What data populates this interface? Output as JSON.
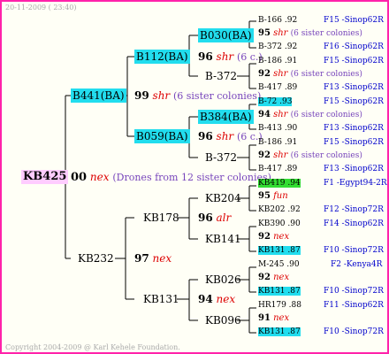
{
  "date": "20-11-2009 ( 23:40)",
  "footer": "Copyright 2004-2009 @ Karl Kehele Foundation.",
  "root": {
    "id": "KB425",
    "gen_num": "00",
    "breed": "nex",
    "note": "(Drones from 12 sister colonies)"
  },
  "top": {
    "id": "B441(BA)",
    "gen_num": "99",
    "breed": "shr",
    "note": "(6 sister colonies)",
    "a": {
      "id": "B112(BA)",
      "gen_num": "96",
      "breed": "shr",
      "note": "(6 c.)",
      "a": {
        "id": "B030(BA)"
      },
      "b": {
        "id": "B-372"
      }
    },
    "b": {
      "id": "B059(BA)",
      "gen_num": "96",
      "breed": "shr",
      "note": "(6 c.)",
      "a": {
        "id": "B384(BA)"
      },
      "b": {
        "id": "B-372"
      }
    }
  },
  "bottom": {
    "id": "KB232",
    "gen_num": "97",
    "breed": "nex",
    "a": {
      "id": "KB178",
      "gen_num": "96",
      "breed": "alr",
      "a": {
        "id": "KB204"
      },
      "b": {
        "id": "KB141"
      }
    },
    "b": {
      "id": "KB131",
      "gen_num": "94",
      "breed": "nex",
      "a": {
        "id": "KB026"
      },
      "b": {
        "id": "KB096"
      }
    }
  },
  "groups": [
    {
      "top": "B-166 .92",
      "top_loc": "F15 -Sinop62R",
      "mid_num": "95",
      "mid_breed": "shr",
      "mid_note": "(6 sister colonies)",
      "bot": "B-372 .92",
      "bot_loc": "F16 -Sinop62R"
    },
    {
      "top": "B-186 .91",
      "top_loc": "F15 -Sinop62R",
      "mid_num": "92",
      "mid_breed": "shr",
      "mid_note": "(6 sister colonies)",
      "bot": "B-417 .89",
      "bot_loc": "F13 -Sinop62R"
    },
    {
      "top": "B-72 .93",
      "top_loc": "F15 -Sinop62R",
      "mid_num": "94",
      "mid_breed": "shr",
      "mid_note": "(6 sister colonies)",
      "bot": "B-413 .90",
      "bot_loc": "F13 -Sinop62R"
    },
    {
      "top": "B-186 .91",
      "top_loc": "F15 -Sinop62R",
      "mid_num": "92",
      "mid_breed": "shr",
      "mid_note": "(6 sister colonies)",
      "bot": "B-417 .89",
      "bot_loc": "F13 -Sinop62R"
    },
    {
      "top": "KB419 .94",
      "top_loc": "F1 -Egypt94-2R",
      "mid_num": "95",
      "mid_breed": "fun",
      "mid_note": "",
      "bot": "KB202 .92",
      "bot_loc": "F12 -Sinop72R"
    },
    {
      "top": "KB390 .90",
      "top_loc": "F14 -Sinop62R",
      "mid_num": "92",
      "mid_breed": "nex",
      "mid_note": "",
      "bot": "KB131 .87",
      "bot_loc": "F10 -Sinop72R"
    },
    {
      "top": "M-245 .90",
      "top_loc": "F2 -Kenya4R",
      "mid_num": "92",
      "mid_breed": "nex",
      "mid_note": "",
      "bot": "KB131 .87",
      "bot_loc": "F10 -Sinop72R"
    },
    {
      "top": "HR179 .88",
      "top_loc": "F11 -Sinop62R",
      "mid_num": "91",
      "mid_breed": "nex",
      "mid_note": "",
      "bot": "KB131 .87",
      "bot_loc": "F10 -Sinop72R"
    }
  ]
}
